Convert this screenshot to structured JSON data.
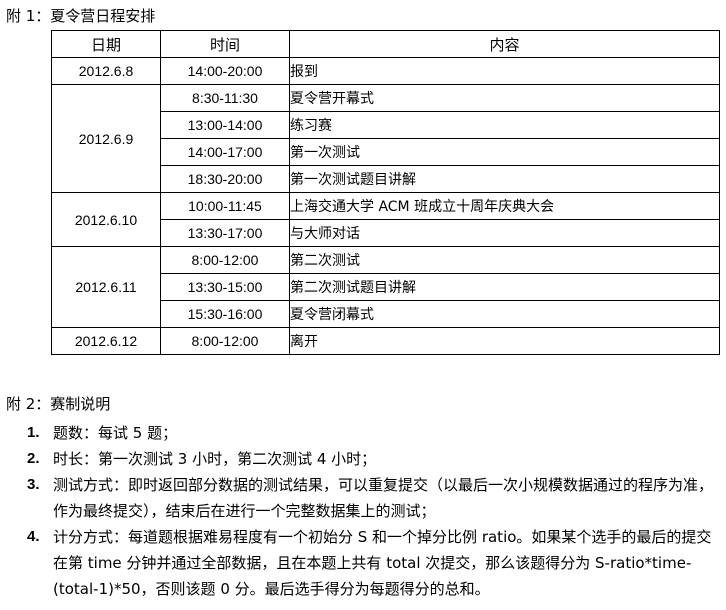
{
  "appendix1": {
    "title": "附 1：夏令营日程安排"
  },
  "table": {
    "headers": {
      "date": "日期",
      "time": "时间",
      "content": "内容"
    },
    "groups": [
      {
        "date": "2012.6.8",
        "rows": [
          {
            "time": "14:00-20:00",
            "content": "报到"
          }
        ]
      },
      {
        "date": "2012.6.9",
        "rows": [
          {
            "time": "8:30-11:30",
            "content": "夏令营开幕式"
          },
          {
            "time": "13:00-14:00",
            "content": "练习赛"
          },
          {
            "time": "14:00-17:00",
            "content": "第一次测试"
          },
          {
            "time": "18:30-20:00",
            "content": "第一次测试题目讲解"
          }
        ]
      },
      {
        "date": "2012.6.10",
        "rows": [
          {
            "time": "10:00-11:45",
            "content": "上海交通大学 ACM 班成立十周年庆典大会"
          },
          {
            "time": "13:30-17:00",
            "content": "与大师对话"
          }
        ]
      },
      {
        "date": "2012.6.11",
        "rows": [
          {
            "time": "8:00-12:00",
            "content": "第二次测试"
          },
          {
            "time": "13:30-15:00",
            "content": "第二次测试题目讲解"
          },
          {
            "time": "15:30-16:00",
            "content": "夏令营闭幕式"
          }
        ]
      },
      {
        "date": "2012.6.12",
        "rows": [
          {
            "time": "8:00-12:00",
            "content": "离开"
          }
        ]
      }
    ]
  },
  "appendix2": {
    "title": "附 2：赛制说明",
    "items": [
      {
        "num": "1.",
        "text": "题数：每试 5 题；"
      },
      {
        "num": "2.",
        "text": "时长：第一次测试 3 小时，第二次测试 4 小时；"
      },
      {
        "num": "3.",
        "text": "测试方式：即时返回部分数据的测试结果，可以重复提交（以最后一次小规模数据通过的程序为准，作为最终提交），结束后在进行一个完整数据集上的测试；"
      },
      {
        "num": "4.",
        "text": "计分方式：每道题根据难易程度有一个初始分 S 和一个掉分比例 ratio。如果某个选手的最后的提交在第 time 分钟并通过全部数据，且在本题上共有 total 次提交，那么该题得分为 S-ratio*time-(total-1)*50，否则该题 0 分。最后选手得分为每题得分的总和。"
      }
    ]
  }
}
